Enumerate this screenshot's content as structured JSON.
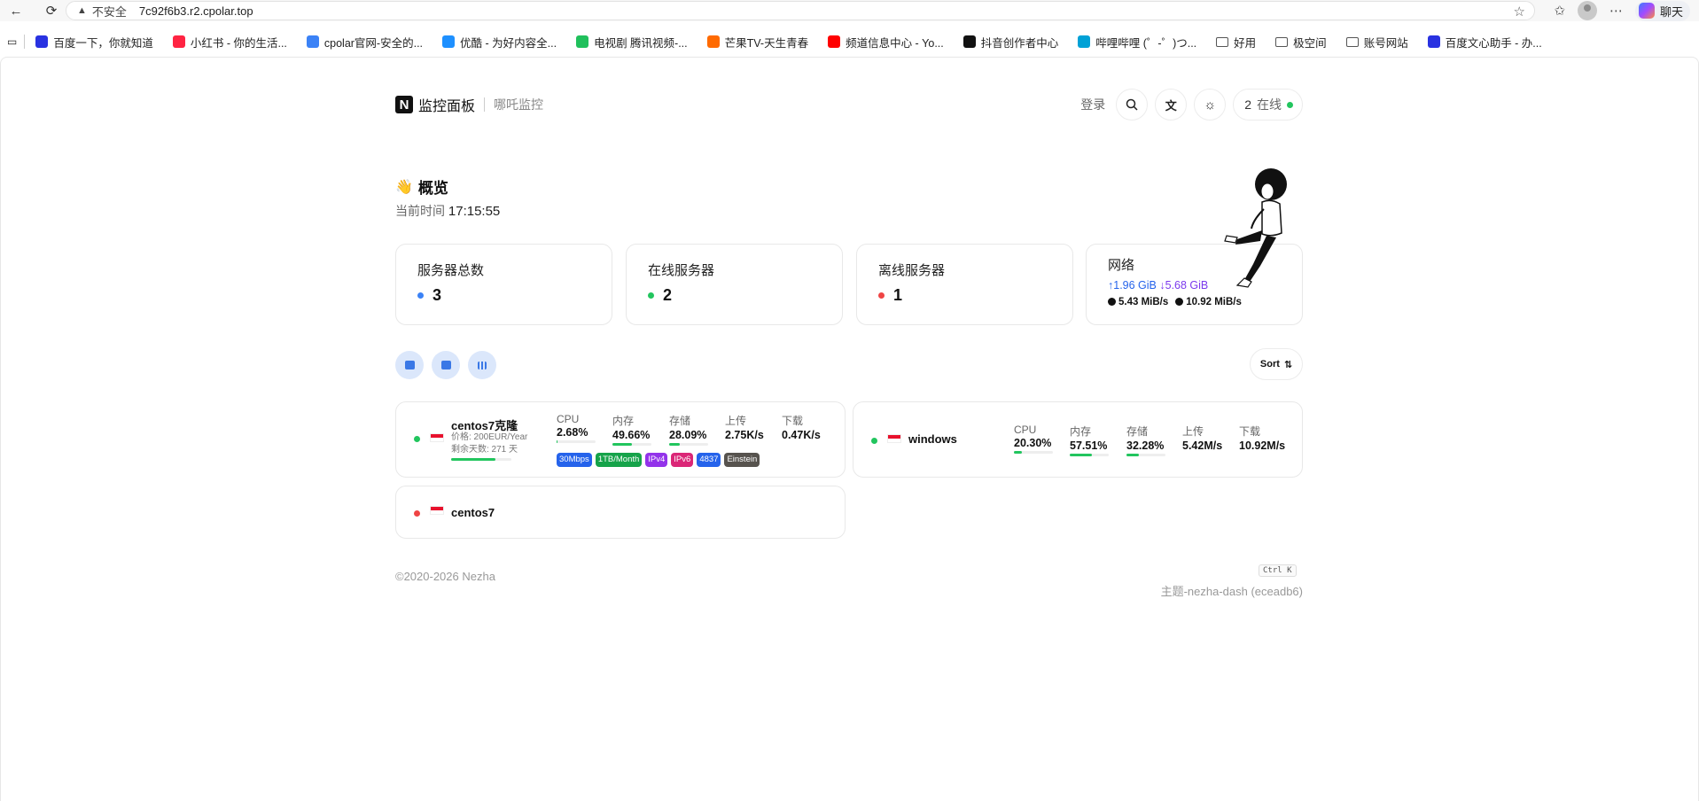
{
  "browser": {
    "security_label": "不安全",
    "url": "7c92f6b3.r2.cpolar.top",
    "chat_label": "聊天"
  },
  "bookmarks": [
    {
      "label": "百度一下，你就知道",
      "color": "#2932e1"
    },
    {
      "label": "小红书 - 你的生活...",
      "color": "#ff2442"
    },
    {
      "label": "cpolar官网-安全的...",
      "color": "#3b82f6"
    },
    {
      "label": "优酷 - 为好内容全...",
      "color": "#1e90ff"
    },
    {
      "label": "电视剧 腾讯视频-...",
      "color": "#20c05c"
    },
    {
      "label": "芒果TV-天生青春",
      "color": "#ff6a00"
    },
    {
      "label": "频道信息中心 - Yo...",
      "color": "#ff0000"
    },
    {
      "label": "抖音创作者中心",
      "color": "#111111"
    },
    {
      "label": "哔哩哔哩 (゜-゜)つ...",
      "color": "#00a1d6"
    },
    {
      "label": "好用",
      "folder": true
    },
    {
      "label": "极空间",
      "folder": true
    },
    {
      "label": "账号网站",
      "folder": true
    },
    {
      "label": "百度文心助手 - 办...",
      "color": "#2932e1"
    }
  ],
  "header": {
    "logo_letter": "N",
    "title": "监控面板",
    "subtitle": "哪吒监控",
    "login": "登录",
    "online_count": "2",
    "online_label": "在线"
  },
  "overview": {
    "title": "概览",
    "time_label": "当前时间",
    "time_value": "17:15:55"
  },
  "stats": {
    "total": {
      "label": "服务器总数",
      "value": "3",
      "color": "#3b82f6"
    },
    "online": {
      "label": "在线服务器",
      "value": "2",
      "color": "#22c55e"
    },
    "offline": {
      "label": "离线服务器",
      "value": "1",
      "color": "#ef4444"
    },
    "network": {
      "label": "网络",
      "up_total": "↑1.96 GiB",
      "down_total": "↓5.68 GiB",
      "up_speed": "5.43 MiB/s",
      "down_speed": "10.92 MiB/s"
    }
  },
  "toolbar": {
    "sort_label": "Sort",
    "icons": [
      "map-icon",
      "chart-icon",
      "grid-icon"
    ]
  },
  "metric_labels": {
    "cpu": "CPU",
    "mem": "内存",
    "disk": "存储",
    "up": "上传",
    "down": "下载"
  },
  "servers": [
    {
      "name": "centos7克隆",
      "status": "online",
      "price": "价格: 200EUR/Year",
      "remaining": "剩余天数: 271 天",
      "remaining_fraction": 0.74,
      "cpu": "2.68%",
      "cpu_pct": 2.68,
      "mem": "49.66%",
      "mem_pct": 49.66,
      "disk": "28.09%",
      "disk_pct": 28.09,
      "up": "2.75K/s",
      "down": "0.47K/s",
      "tags": [
        {
          "text": "30Mbps",
          "color": "#2563eb"
        },
        {
          "text": "1TB/Month",
          "color": "#16a34a"
        },
        {
          "text": "IPv4",
          "color": "#9333ea"
        },
        {
          "text": "IPv6",
          "color": "#db2777"
        },
        {
          "text": "4837",
          "color": "#2563eb"
        },
        {
          "text": "Einstein",
          "color": "#57534e"
        }
      ]
    },
    {
      "name": "windows",
      "status": "online",
      "cpu": "20.30%",
      "cpu_pct": 20.3,
      "mem": "57.51%",
      "mem_pct": 57.51,
      "disk": "32.28%",
      "disk_pct": 32.28,
      "up": "5.42M/s",
      "down": "10.92M/s"
    },
    {
      "name": "centos7",
      "status": "offline"
    }
  ],
  "footer": {
    "copyright": "©2020-2026 Nezha",
    "shortcut": "Ctrl K",
    "theme": "主题-nezha-dash (eceadb6)"
  },
  "colors": {
    "online": "#22c55e",
    "offline": "#ef4444",
    "accent": "#3b82f6"
  }
}
